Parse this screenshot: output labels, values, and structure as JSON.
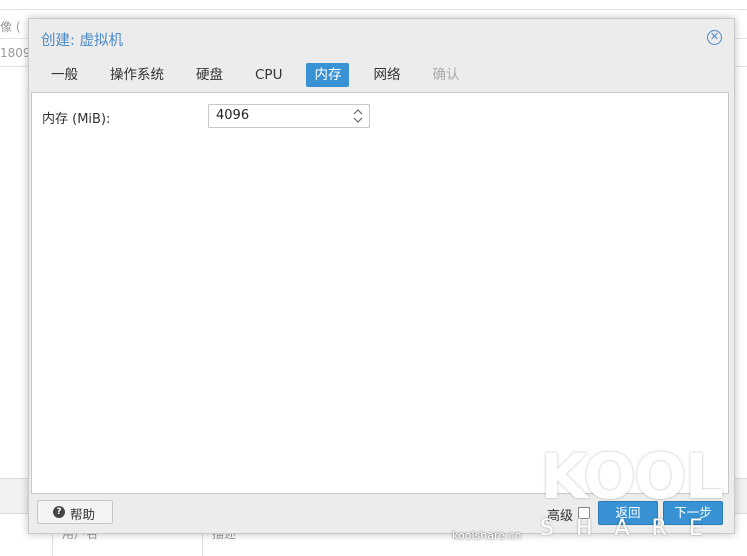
{
  "background": {
    "col_top": "像 (",
    "row_text": "1809",
    "bottom_col1": "用户名",
    "bottom_col2": "描述"
  },
  "dialog": {
    "title": "创建: 虚拟机",
    "close_icon": "close-circle-icon",
    "tabs": [
      {
        "label": "一般",
        "state": "normal"
      },
      {
        "label": "操作系统",
        "state": "normal"
      },
      {
        "label": "硬盘",
        "state": "normal"
      },
      {
        "label": "CPU",
        "state": "normal"
      },
      {
        "label": "内存",
        "state": "active"
      },
      {
        "label": "网络",
        "state": "normal"
      },
      {
        "label": "确认",
        "state": "disabled"
      }
    ],
    "memory": {
      "label": "内存 (MiB):",
      "value": "4096"
    },
    "footer": {
      "help_label": "帮助",
      "advanced_label": "高级",
      "back_label": "返回",
      "next_label": "下一步"
    }
  },
  "colors": {
    "accent": "#3892d4",
    "title": "#4a8ac8",
    "disabled_tab": "#aaaaaa"
  },
  "watermark": {
    "logo": "KOOL",
    "sub": "SHARE",
    "site": "koolshare.cn"
  }
}
